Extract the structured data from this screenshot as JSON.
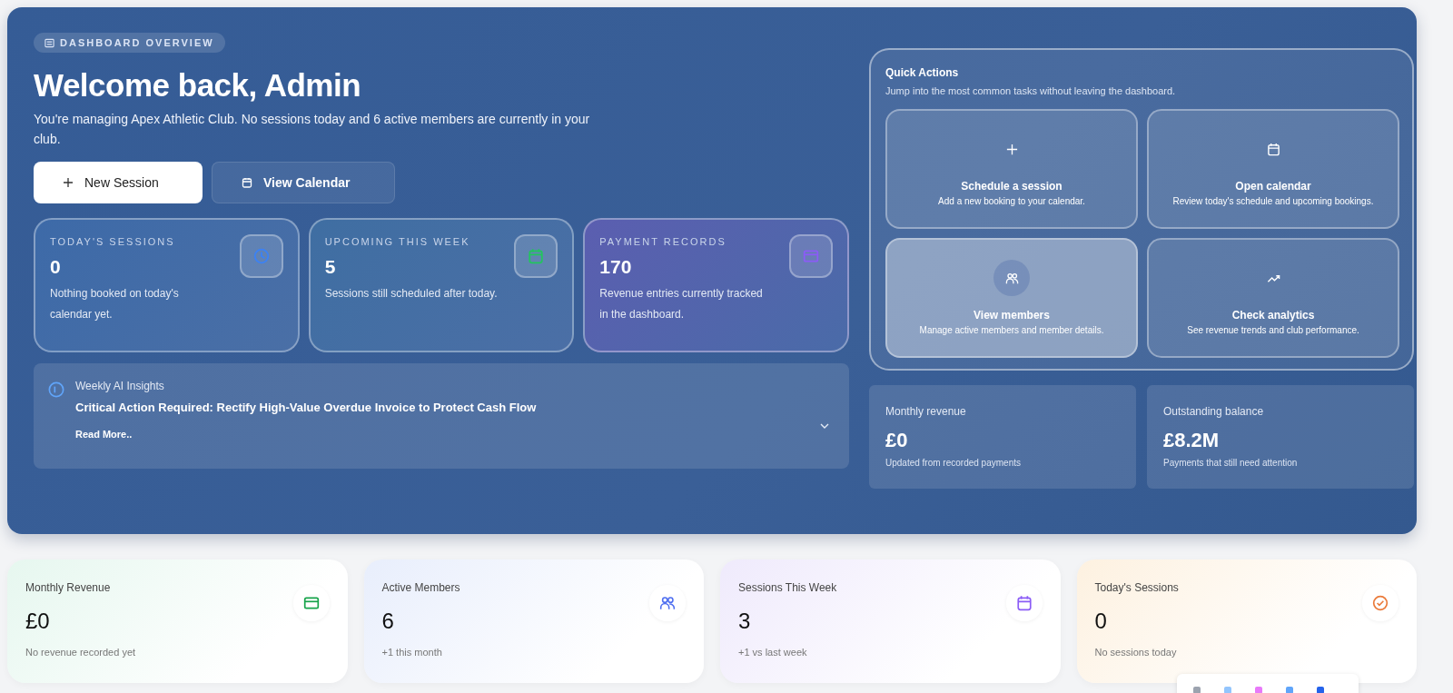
{
  "badge": {
    "label": "DASHBOARD OVERVIEW"
  },
  "hero": {
    "title": "Welcome back, Admin",
    "subtitle": "You're managing Apex Athletic Club. No sessions today and 6 active members are currently in your club.",
    "buttons": [
      {
        "label": "New Session",
        "kind": "primary"
      },
      {
        "label": "View Calendar",
        "kind": "secondary"
      }
    ]
  },
  "summary_cards": [
    {
      "label": "TODAY'S SESSIONS",
      "value": "0",
      "note": "Nothing booked on today's calendar yet.",
      "kind": "clock",
      "color": "#3b82f6"
    },
    {
      "label": "UPCOMING THIS WEEK",
      "value": "5",
      "note": "Sessions still scheduled after today.",
      "kind": "calendar",
      "color": "#22c55e"
    },
    {
      "label": "PAYMENT RECORDS",
      "value": "170",
      "note": "Revenue entries currently tracked in the dashboard.",
      "kind": "card",
      "color": "#8b5cf6"
    }
  ],
  "insights": {
    "title": "Weekly AI Insights",
    "headline": "Critical Action Required: Rectify High-Value Overdue Invoice to Protect Cash Flow",
    "link": "Read More.."
  },
  "quick_actions": {
    "title": "Quick Actions",
    "subtitle": "Jump into the most common tasks without leaving the dashboard.",
    "items": [
      {
        "kind": "plus",
        "title": "Schedule a session",
        "text": "Add a new booking to your calendar.",
        "selected": false
      },
      {
        "kind": "calendar",
        "title": "Open calendar",
        "text": "Review today's schedule and upcoming bookings.",
        "selected": false
      },
      {
        "kind": "members",
        "title": "View members",
        "text": "Manage active members and member details.",
        "selected": true
      },
      {
        "kind": "trend",
        "title": "Check analytics",
        "text": "See revenue trends and club performance.",
        "selected": false
      }
    ]
  },
  "finance": [
    {
      "label": "Monthly revenue",
      "value": "£0",
      "note": "Updated from recorded payments"
    },
    {
      "label": "Outstanding balance",
      "value": "£8.2M",
      "note": "Payments that still need attention"
    }
  ],
  "stats": [
    {
      "label": "Monthly Revenue",
      "value": "£0",
      "note": "No revenue recorded yet",
      "kind": "card",
      "color": "#16a34a"
    },
    {
      "label": "Active Members",
      "value": "6",
      "note": "+1 this month",
      "kind": "members",
      "color": "#4f6ff0"
    },
    {
      "label": "Sessions This Week",
      "value": "3",
      "note": "+1 vs last week",
      "kind": "calendar",
      "color": "#8b5cf6"
    },
    {
      "label": "Today's Sessions",
      "value": "0",
      "note": "No sessions today",
      "kind": "check",
      "color": "#ea7a3a"
    }
  ]
}
